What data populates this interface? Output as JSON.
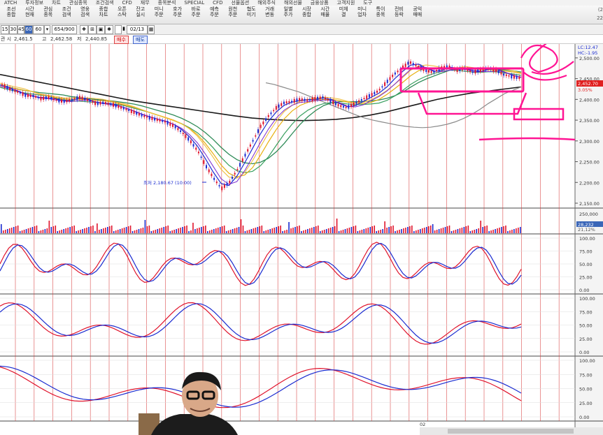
{
  "menubar": {
    "items": [
      "ATCH",
      "투자정보",
      "차트",
      "관심종목",
      "조건검색",
      "CFD",
      "재무",
      "종목분석",
      "SPECIAL",
      "CFD",
      "선물옵션",
      "해외주식",
      "해외선물",
      "금융상품",
      "고객지원",
      "도구"
    ]
  },
  "toolbar": {
    "buttons": [
      {
        "l1": "조선",
        "l2": "종합"
      },
      {
        "l1": "시간",
        "l2": "현재"
      },
      {
        "l1": "관심",
        "l2": "종목"
      },
      {
        "l1": "조건",
        "l2": "검색"
      },
      {
        "l1": "영웅",
        "l2": "검색"
      },
      {
        "l1": "종합",
        "l2": "차트"
      },
      {
        "l1": "오픈",
        "l2": "스탁"
      },
      {
        "l1": "잔고",
        "l2": "실시"
      },
      {
        "l1": "미니",
        "l2": "주문"
      },
      {
        "l1": "호가",
        "l2": "주문"
      },
      {
        "l1": "바로",
        "l2": "주문"
      },
      {
        "l1": "예측",
        "l2": "주문"
      },
      {
        "l1": "원천",
        "l2": "주문"
      },
      {
        "l1": "협도",
        "l2": "미기"
      },
      {
        "l1": "거래",
        "l2": "변동"
      },
      {
        "l1": "일별",
        "l2": "주가"
      },
      {
        "l1": "시장",
        "l2": "종합"
      },
      {
        "l1": "시간",
        "l2": "매물"
      },
      {
        "l1": "미체",
        "l2": "결"
      },
      {
        "l1": "미니",
        "l2": "업차"
      },
      {
        "l1": "특이",
        "l2": "종목"
      },
      {
        "l1": "전비",
        "l2": "등락"
      },
      {
        "l1": "공익",
        "l2": "매매"
      }
    ],
    "clock": {
      "top": "(2",
      "bottom": "22"
    }
  },
  "controls": {
    "periods": [
      "15",
      "30",
      "45",
      "60"
    ],
    "selected_period": "60",
    "count_value": "60",
    "bars_value": "654/900",
    "date_value": "02/13"
  },
  "info": {
    "open_label": "관 시",
    "open_value": "2,461.5",
    "high_label": "고",
    "high_value": "2,462.58",
    "low_label": "저",
    "low_value": "2,440.85",
    "buy_label": "매수",
    "sell_label": "매도"
  },
  "chart_labels": {
    "price_axis": [
      "2,500.00",
      "2,450.00",
      "2,400.00",
      "2,350.00",
      "2,300.00",
      "2,250.00",
      "2,200.00",
      "2,150.00"
    ],
    "volume_axis": [
      "250,000"
    ],
    "osc_axis": [
      "100.00",
      "75.00",
      "50.00",
      "25.00",
      "0.00"
    ],
    "low_annotation": "최저 2,180.67 (10:00)",
    "current_price": "2,452.70",
    "pct_change": "3.05%",
    "lc_label": "LC:12.47",
    "hc_label": "HC:-1.95",
    "vol_tag1": "28,232",
    "vol_tag2": "21,12%",
    "date_tick": "02"
  },
  "colors": {
    "red": "#e0142c",
    "blue": "#1a2bd0",
    "pink": "#ff1493",
    "green": "#2e8b57",
    "gold": "#e8b010",
    "black": "#1a1a1a",
    "gray": "#8a8a8a"
  },
  "chart_data": {
    "type": "candlestick",
    "y_range": [
      2150,
      2520
    ],
    "price_series_approx": [
      2435,
      2425,
      2418,
      2410,
      2408,
      2402,
      2405,
      2398,
      2395,
      2400,
      2405,
      2398,
      2390,
      2392,
      2388,
      2382,
      2375,
      2368,
      2360,
      2355,
      2350,
      2345,
      2335,
      2320,
      2300,
      2275,
      2240,
      2210,
      2185,
      2200,
      2230,
      2265,
      2300,
      2335,
      2360,
      2380,
      2392,
      2395,
      2400,
      2398,
      2402,
      2405,
      2395,
      2385,
      2380,
      2390,
      2400,
      2410,
      2420,
      2440,
      2460,
      2475,
      2490,
      2480,
      2470,
      2465,
      2475,
      2480,
      2470,
      2475,
      2465,
      2470,
      2475,
      2470,
      2460,
      2455,
      2452
    ],
    "ma_black": [
      2460,
      2452,
      2444,
      2436,
      2428,
      2420,
      2412,
      2404,
      2396,
      2390,
      2384,
      2378,
      2372,
      2366,
      2360,
      2355,
      2352,
      2350,
      2349,
      2350,
      2352,
      2356,
      2362,
      2370,
      2380,
      2390,
      2400,
      2408,
      2415,
      2420,
      2425,
      2430
    ],
    "ma_gray": [
      2440,
      2436,
      2430,
      2424,
      2418,
      2410,
      2402,
      2394,
      2386,
      2378,
      2370,
      2362,
      2355,
      2350,
      2346,
      2342,
      2338,
      2335,
      2333,
      2332,
      2333,
      2336,
      2340,
      2346,
      2354,
      2364,
      2376,
      2390,
      2402,
      2414,
      2422,
      2430
    ]
  }
}
